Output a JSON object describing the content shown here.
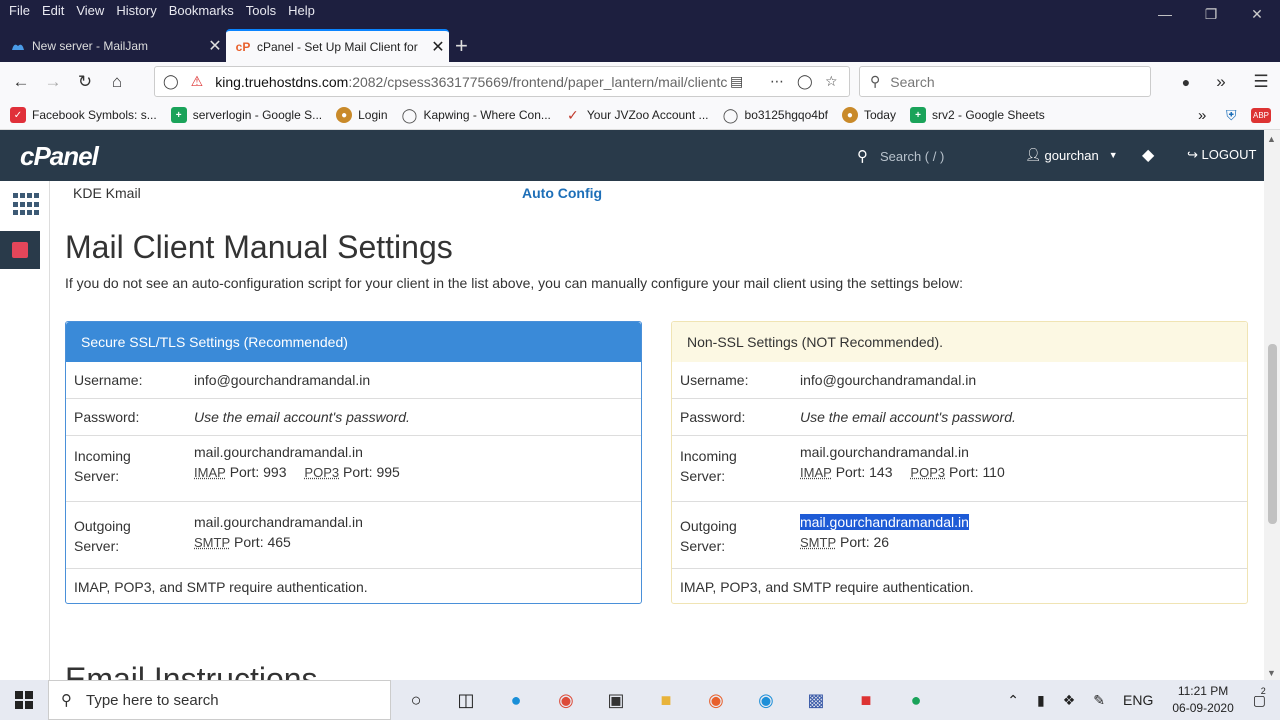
{
  "menubar": {
    "items": [
      "File",
      "Edit",
      "View",
      "History",
      "Bookmarks",
      "Tools",
      "Help"
    ]
  },
  "tabs": [
    {
      "label": "New server - MailJam"
    },
    {
      "label": "cPanel - Set Up Mail Client for"
    }
  ],
  "url": {
    "host": "king.truehostdns.com",
    "rest": ":2082/cpsess3631775669/frontend/paper_lantern/mail/clientc"
  },
  "browser_search": {
    "placeholder": "Search"
  },
  "bookmarks": [
    {
      "label": "Facebook Symbols: s...",
      "color": "#e0303a"
    },
    {
      "label": "serverlogin - Google S...",
      "color": "#1aa35a"
    },
    {
      "label": "Login",
      "color": "#c98a2a"
    },
    {
      "label": "Kapwing - Where Con...",
      "color": "#555555"
    },
    {
      "label": "Your JVZoo Account ...",
      "color": "#c0392b"
    },
    {
      "label": "bo3125hgqo4bf",
      "color": "#555555"
    },
    {
      "label": "Today",
      "color": "#c98a2a"
    },
    {
      "label": "srv2 - Google Sheets",
      "color": "#1aa35a"
    }
  ],
  "cpanel": {
    "logo": "cPanel",
    "search_placeholder": "Search ( / )",
    "user": "gourchan",
    "logout": "LOGOUT"
  },
  "main": {
    "kde_label": "KDE Kmail",
    "auto_config": "Auto Config",
    "title": "Mail Client Manual Settings",
    "intro": "If you do not see an auto-configuration script for your client in the list above, you can manually configure your mail client using the settings below:",
    "ssl": {
      "heading": "Secure SSL/TLS Settings (Recommended)",
      "username_label": "Username:",
      "username": "info@gourchandramandal.in",
      "password_label": "Password:",
      "password": "Use the email account's password.",
      "incoming_label": "Incoming Server:",
      "incoming_host": "mail.gourchandramandal.in",
      "imap": "IMAP",
      "imap_port": "Port: 993",
      "pop3": "POP3",
      "pop3_port": "Port: 995",
      "outgoing_label": "Outgoing Server:",
      "outgoing_host": "mail.gourchandramandal.in",
      "smtp": "SMTP",
      "smtp_port": "Port: 465",
      "auth_note": "IMAP, POP3, and SMTP require authentication."
    },
    "nonssl": {
      "heading": "Non-SSL Settings (NOT Recommended).",
      "username_label": "Username:",
      "username": "info@gourchandramandal.in",
      "password_label": "Password:",
      "password": "Use the email account's password.",
      "incoming_label": "Incoming Server:",
      "incoming_host": "mail.gourchandramandal.in",
      "imap": "IMAP",
      "imap_port": "Port: 143",
      "pop3": "POP3",
      "pop3_port": "Port: 110",
      "outgoing_label": "Outgoing Server:",
      "outgoing_host": "mail.gourchandramandal.in",
      "smtp": "SMTP",
      "smtp_port": "Port: 26",
      "auth_note": "IMAP, POP3, and SMTP require authentication."
    },
    "next_title": "Email Instructions"
  },
  "taskbar": {
    "search_placeholder": "Type here to search",
    "lang": "ENG",
    "time": "11:21 PM",
    "date": "06-09-2020",
    "notifications": "2"
  }
}
